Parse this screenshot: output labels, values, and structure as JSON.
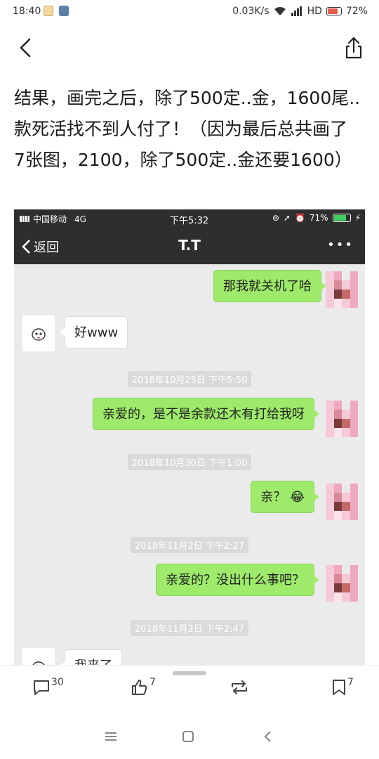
{
  "status_bar": {
    "time": "18:40",
    "net_speed": "0.03K/s",
    "hd": "HD",
    "battery": "72%",
    "battery_level": 0.72
  },
  "post": {
    "lines": [
      "结果，画完之后，除了500定..金，1600尾..",
      "款死活找不到人付了！（因为最后总共画了",
      "7张图，2100，除了500定..金还要1600）"
    ]
  },
  "screenshot": {
    "status": {
      "carrier": "中国移动",
      "network": "4G",
      "time": "下午5:32",
      "battery": "71%",
      "battery_level": 0.71
    },
    "nav": {
      "back_label": "返回",
      "title": "T.T",
      "more": "•••"
    },
    "messages": [
      {
        "type": "sent",
        "text": "那我就关机了哈"
      },
      {
        "type": "recv",
        "text": "好www"
      },
      {
        "type": "time",
        "text": "2018年10月25日 下午5:50"
      },
      {
        "type": "sent",
        "text": "亲爱的，是不是余款还木有打给我呀"
      },
      {
        "type": "time",
        "text": "2018年10月30日 下午1:00"
      },
      {
        "type": "sent",
        "text": "亲？",
        "emoji": "😂"
      },
      {
        "type": "time",
        "text": "2018年11月2日 下午2:27"
      },
      {
        "type": "sent",
        "text": "亲爱的？没出什么事吧？"
      },
      {
        "type": "time",
        "text": "2018年11月2日 下午2:47"
      },
      {
        "type": "recv",
        "text": "我来了"
      }
    ]
  },
  "actions": {
    "comments": "30",
    "likes": "7",
    "favorites": "7"
  },
  "colors": {
    "sent_bubble": "#9eea6a",
    "wechat_bar": "#2e2e2e",
    "chat_bg": "#ebebeb"
  }
}
